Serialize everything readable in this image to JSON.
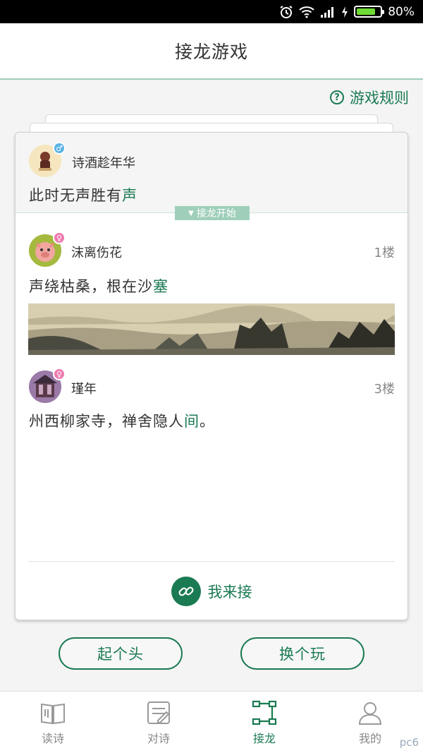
{
  "status": {
    "battery": "80%",
    "battery_level": 0.8
  },
  "header": {
    "title": "接龙游戏"
  },
  "rules": {
    "label": "游戏规则"
  },
  "origin": {
    "username": "诗酒趁年华",
    "gender": "♂",
    "verse_prefix": "此时无声胜有",
    "verse_highlight": "声"
  },
  "start_tag": {
    "label": "接龙开始"
  },
  "replies": [
    {
      "username": "沫离伤花",
      "gender": "♀",
      "floor": "1楼",
      "verse_prefix": "声绕枯桑，根在沙",
      "verse_highlight": "塞",
      "verse_suffix": ""
    },
    {
      "username": "瑾年",
      "gender": "♀",
      "floor": "3楼",
      "verse_prefix": "州西柳家寺，禅舍隐人",
      "verse_highlight": "间",
      "verse_suffix": "。"
    }
  ],
  "join": {
    "label": "我来接"
  },
  "buttons": {
    "start": "起个头",
    "switch": "换个玩"
  },
  "nav": [
    {
      "label": "读诗",
      "icon": "book-icon"
    },
    {
      "label": "对诗",
      "icon": "edit-icon"
    },
    {
      "label": "接龙",
      "icon": "chain-nodes-icon"
    },
    {
      "label": "我的",
      "icon": "user-icon"
    }
  ],
  "watermark": "pc6",
  "colors": {
    "accent": "#1a7a52",
    "accent_light": "#9fcfba"
  }
}
